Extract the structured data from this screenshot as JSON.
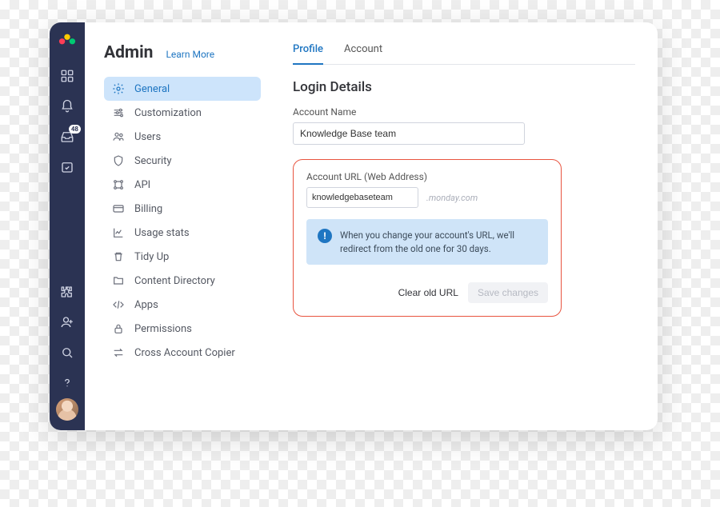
{
  "rail": {
    "inbox_badge": "48"
  },
  "sidebar": {
    "title": "Admin",
    "learn_more": "Learn More",
    "items": [
      {
        "label": "General"
      },
      {
        "label": "Customization"
      },
      {
        "label": "Users"
      },
      {
        "label": "Security"
      },
      {
        "label": "API"
      },
      {
        "label": "Billing"
      },
      {
        "label": "Usage stats"
      },
      {
        "label": "Tidy Up"
      },
      {
        "label": "Content Directory"
      },
      {
        "label": "Apps"
      },
      {
        "label": "Permissions"
      },
      {
        "label": "Cross Account Copier"
      }
    ]
  },
  "tabs": {
    "profile": "Profile",
    "account": "Account"
  },
  "section": {
    "heading": "Login Details",
    "account_name_label": "Account Name",
    "account_name_value": "Knowledge Base team",
    "account_url_label": "Account URL (Web Address)",
    "account_url_value": "knowledgebaseteam",
    "account_url_domain": ".monday.com",
    "notice_text": "When you change your account's URL, we'll redirect from the old one for 30 days.",
    "clear_btn": "Clear old URL",
    "save_btn": "Save changes"
  }
}
